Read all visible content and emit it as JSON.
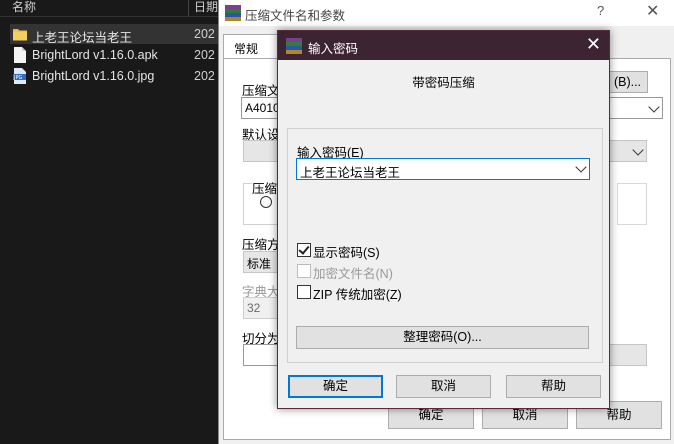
{
  "explorer": {
    "col_name": "名称",
    "col_date": "日期",
    "files": [
      {
        "name": "上老王论坛当老王",
        "date": "202",
        "icon": "folder-icon"
      },
      {
        "name": "BrightLord v1.16.0.apk",
        "date": "202",
        "icon": "file-icon"
      },
      {
        "name": "BrightLord v1.16.0.jpg",
        "date": "202",
        "icon": "jpg-icon"
      }
    ]
  },
  "bg_dialog": {
    "title": "压缩文件名和参数",
    "help_glyph": "?",
    "close_glyph": "✕",
    "tab_general": "常规",
    "archive_label": "压缩文",
    "archive_value": "A4010",
    "browse_btn": "(B)...",
    "default_label": "默认设",
    "compress_fmt_label": "压缩",
    "method_label": "压缩方",
    "method_value": "标准",
    "dict_label": "字典大",
    "dict_value": "32",
    "split_label": "切分为",
    "ok": "确定",
    "cancel": "取消",
    "help": "帮助"
  },
  "pw_dialog": {
    "title": "输入密码",
    "close_glyph": "✕",
    "heading": "带密码压缩",
    "input_label": "输入密码(E)",
    "password_value": "上老王论坛当老王",
    "show_password": {
      "label": "显示密码(S)",
      "checked": true,
      "enabled": true
    },
    "encrypt_names": {
      "label": "加密文件名(N)",
      "checked": false,
      "enabled": false
    },
    "zip_legacy": {
      "label": "ZIP 传统加密(Z)",
      "checked": false,
      "enabled": true
    },
    "organize_btn": "整理密码(O)...",
    "ok": "确定",
    "cancel": "取消",
    "help": "帮助"
  }
}
